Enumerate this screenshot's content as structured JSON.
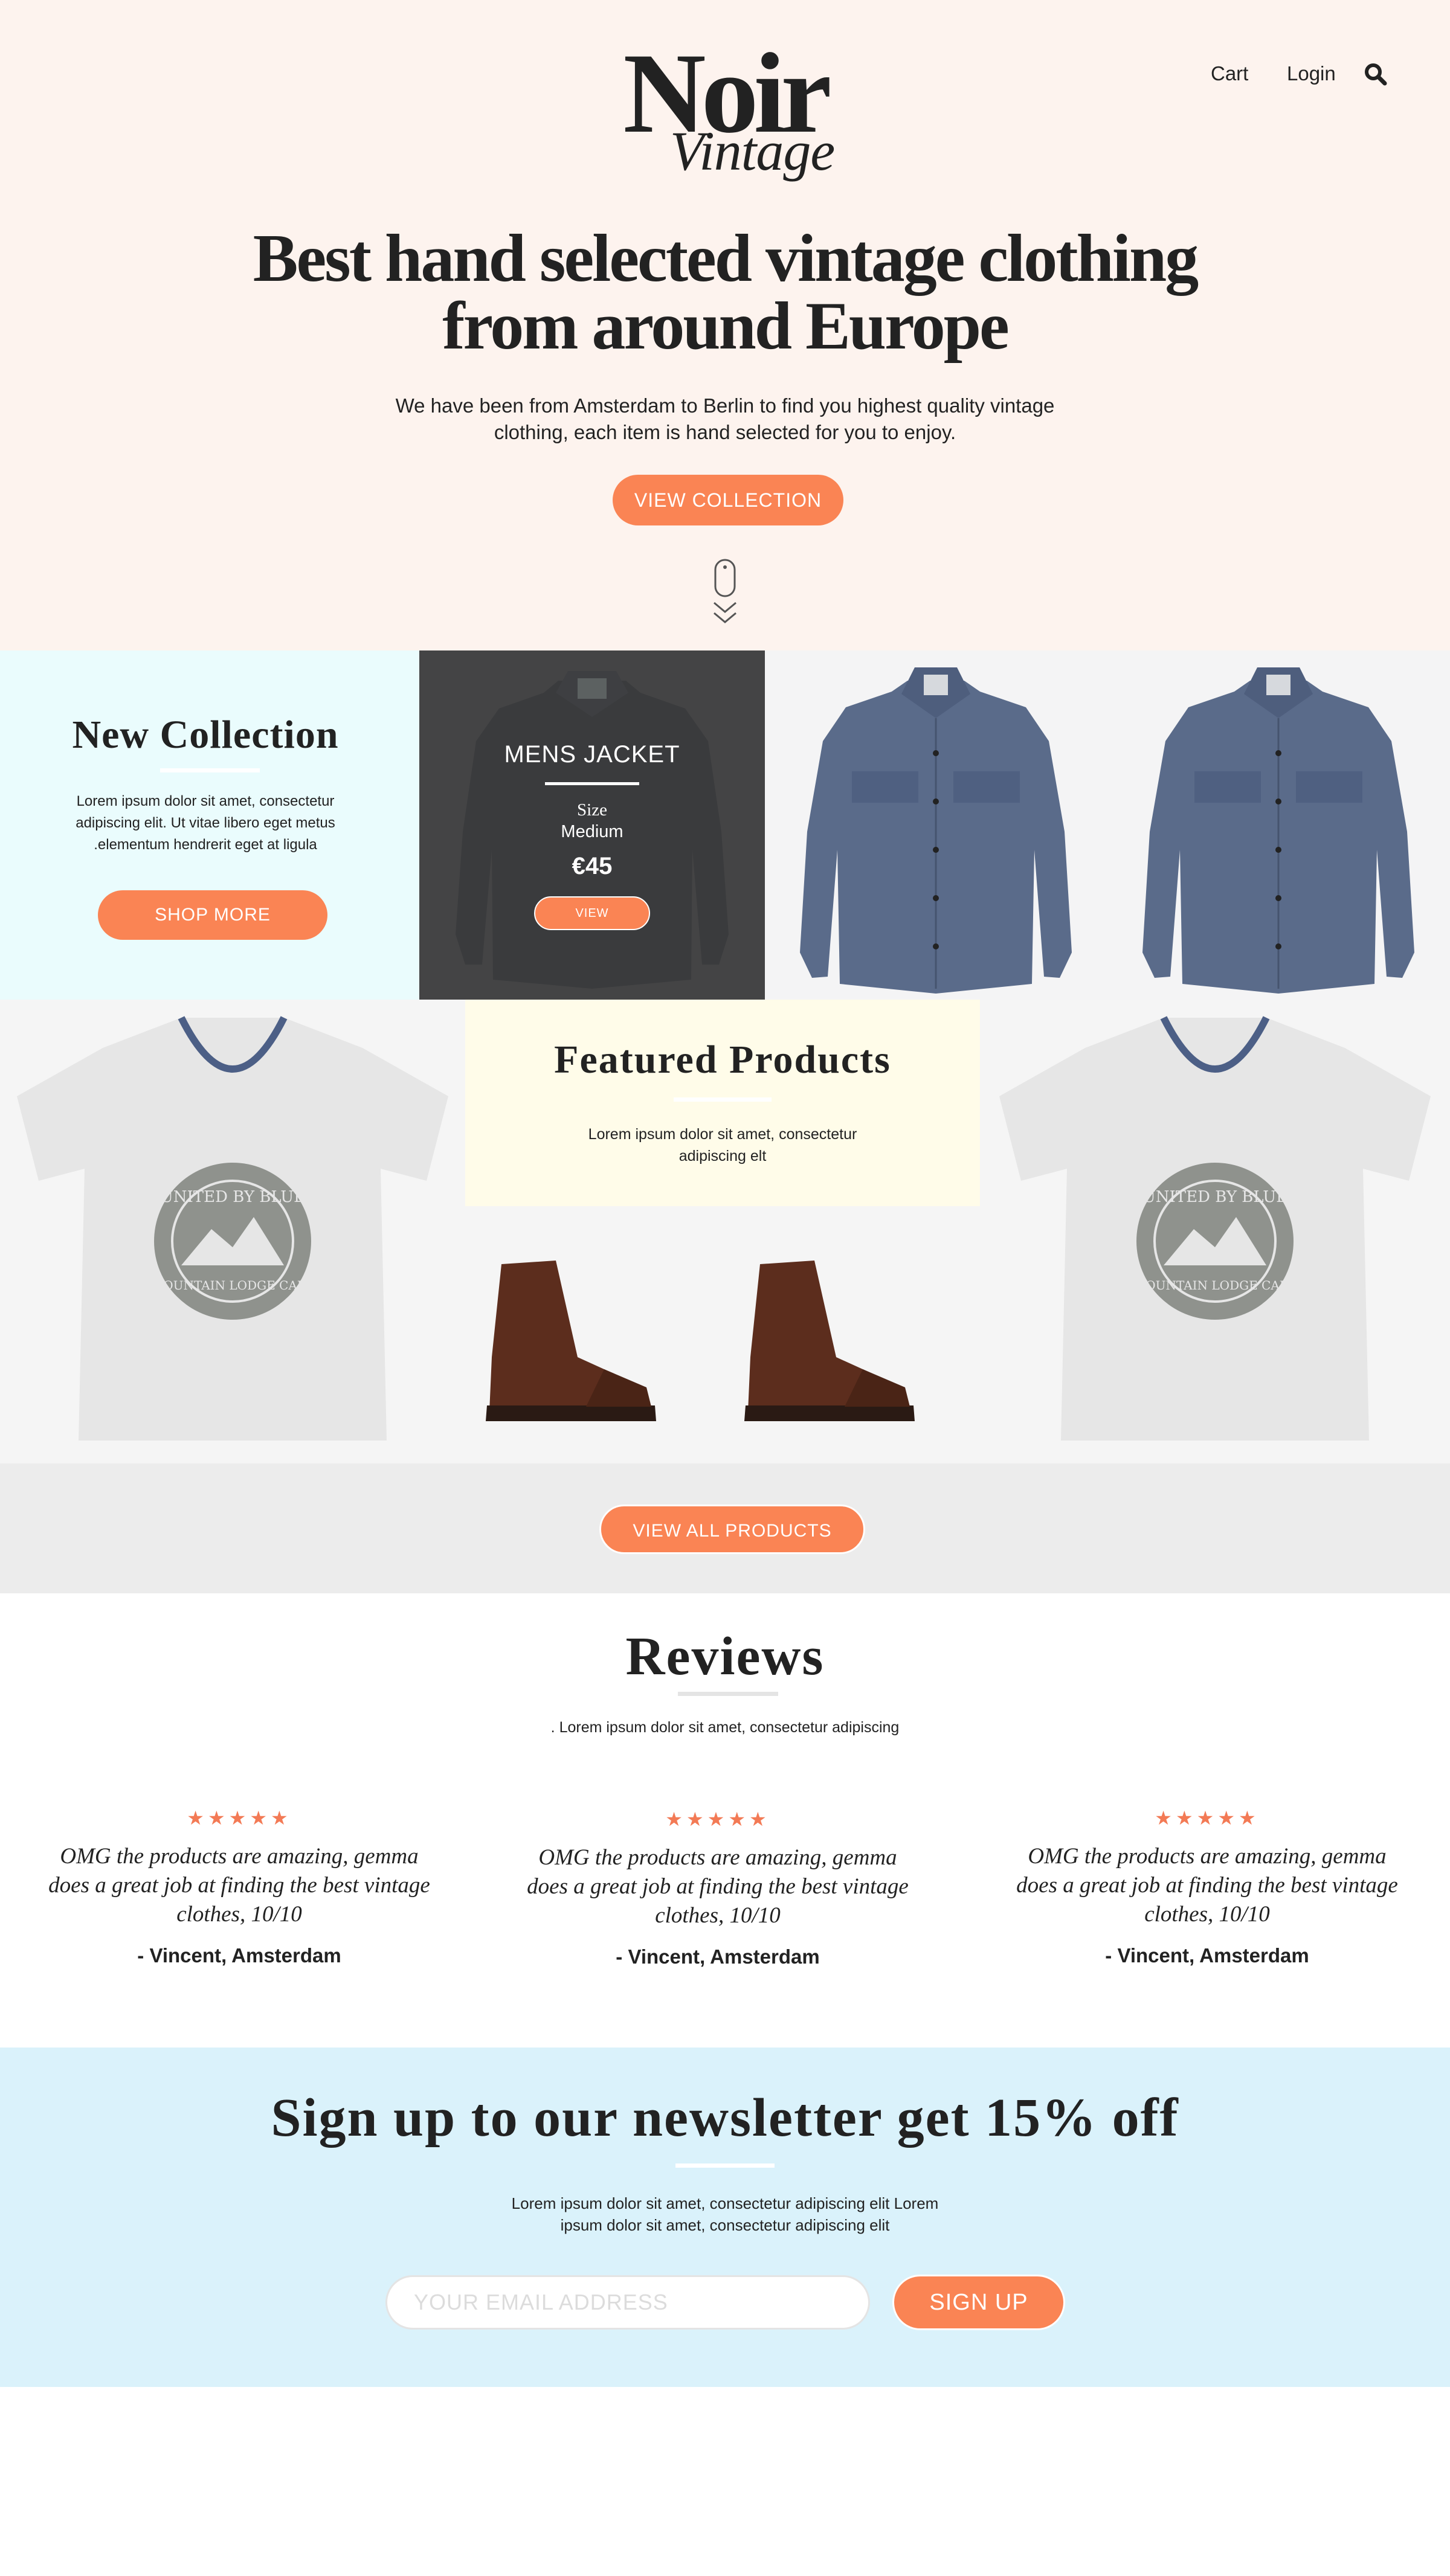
{
  "colors": {
    "accent": "#fa8454",
    "hero_bg": "#fdf3ee",
    "collection_bg": "#eafcfd",
    "featured_bg": "#fffce9",
    "newsletter_bg": "#daf2fb",
    "star": "#f37a55"
  },
  "logo": {
    "main": "Noir",
    "sub": "Vintage"
  },
  "nav": {
    "cart": "Cart",
    "login": "Login",
    "search_icon": "search-icon"
  },
  "hero": {
    "title_line1": "Best hand selected vintage clothing",
    "title_line2": "from around Europe",
    "subtitle_line1": "We have been from Amsterdam to Berlin to find you highest quality vintage",
    "subtitle_line2": "clothing, each item is hand selected for you to enjoy.",
    "button": "VIEW COLLECTION",
    "scroll_icon": "mouse-scroll-icon"
  },
  "new_collection": {
    "title": "New Collection",
    "text_line1": "Lorem ipsum dolor sit amet, consectetur",
    "text_line2": "adipiscing elit. Ut vitae libero eget metus",
    "text_line3": ".elementum hendrerit eget at ligula",
    "button": "SHOP MORE"
  },
  "product_overlay": {
    "name": "MENS JACKET",
    "size_label": "Size",
    "size_value": "Medium",
    "price": "€45",
    "button": "VIEW"
  },
  "featured": {
    "title": "Featured Products",
    "text_line1": "Lorem ipsum dolor sit amet, consectetur",
    "text_line2": "adipiscing elt",
    "tee_badge_top": "UNITED BY BLUE",
    "tee_badge_bottom": "MOUNTAIN LODGE CAFE",
    "button": "VIEW ALL PRODUCTS"
  },
  "reviews": {
    "title": "Reviews",
    "subtitle": ". Lorem ipsum dolor sit amet, consectetur adipiscing",
    "items": [
      {
        "stars": "★★★★★",
        "rating": 5,
        "quote_line1": "OMG the products are amazing, gemma",
        "quote_line2": "does a great job at finding the best vintage",
        "quote_line3": "clothes, 10/10",
        "author": "- Vincent, Amsterdam"
      },
      {
        "stars": "★★★★★",
        "rating": 5,
        "quote_line1": "OMG the products are amazing, gemma",
        "quote_line2": "does a great job at finding the best vintage",
        "quote_line3": "clothes, 10/10",
        "author": "- Vincent, Amsterdam"
      },
      {
        "stars": "★★★★★",
        "rating": 5,
        "quote_line1": "OMG the products are amazing, gemma",
        "quote_line2": "does a great job at finding the best vintage",
        "quote_line3": "clothes, 10/10",
        "author": "- Vincent, Amsterdam"
      }
    ]
  },
  "newsletter": {
    "title": "Sign up to our newsletter get 15% off",
    "text_line1": "Lorem ipsum dolor sit amet, consectetur adipiscing elit Lorem",
    "text_line2": "ipsum dolor sit amet, consectetur adipiscing elit",
    "email_placeholder": "YOUR EMAIL ADDRESS",
    "email_value": "",
    "button": "SIGN UP"
  }
}
